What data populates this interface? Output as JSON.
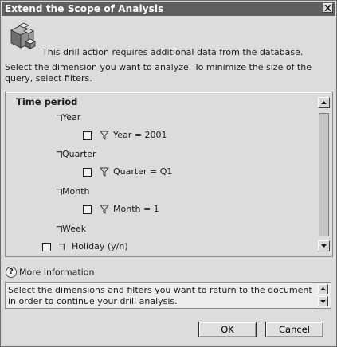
{
  "window": {
    "title": "Extend the Scope of Analysis"
  },
  "intro": "This drill action requires additional data from the database.",
  "instruction": "Select the dimension you want to analyze. To minimize the size of the query, select filters.",
  "tree": {
    "header": "Time period",
    "levels": [
      {
        "label": "Year",
        "filter": "Year = 2001"
      },
      {
        "label": "Quarter",
        "filter": "Quarter = Q1"
      },
      {
        "label": "Month",
        "filter": "Month = 1"
      },
      {
        "label": "Week"
      }
    ],
    "holiday_label": "Holiday (y/n)"
  },
  "more_info": {
    "label": "More Information"
  },
  "info_text": "Select the dimensions and filters you want to return to the document in order to continue your drill analysis.",
  "buttons": {
    "ok": "OK",
    "cancel": "Cancel"
  }
}
